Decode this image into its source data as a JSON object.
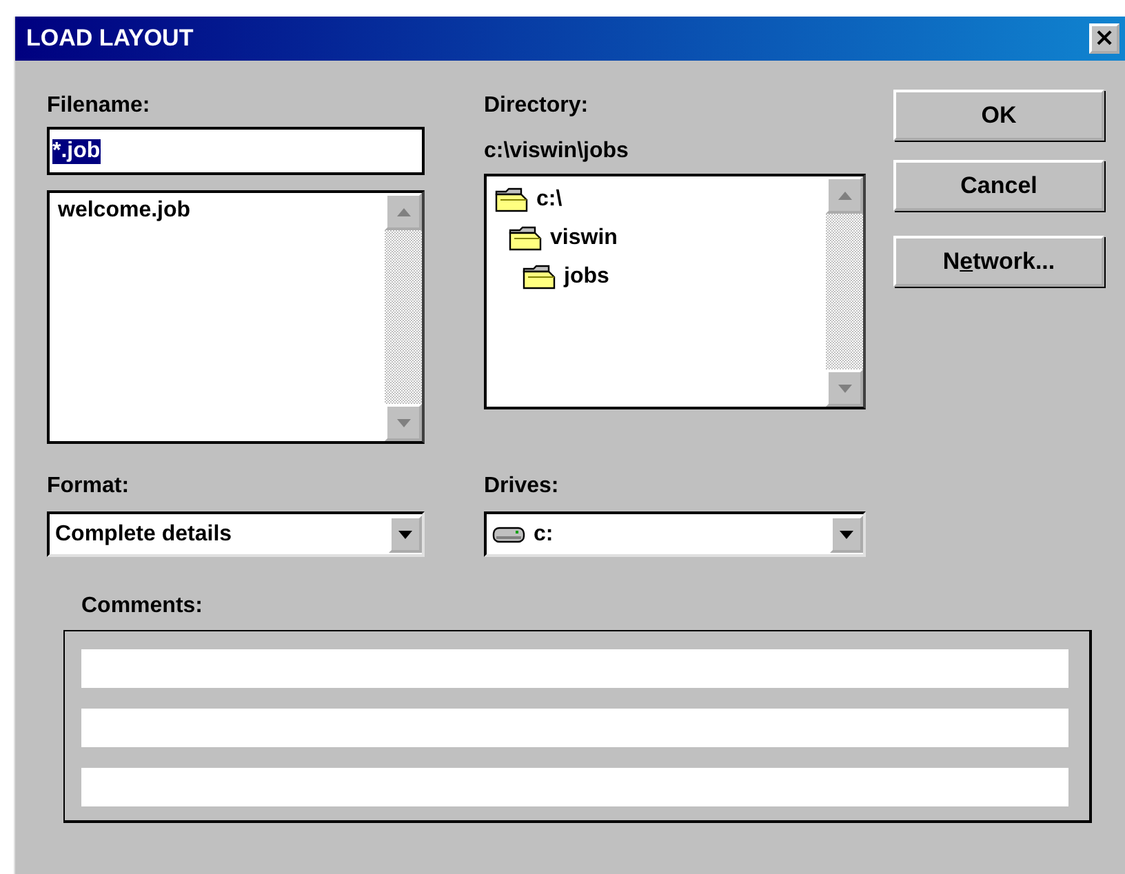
{
  "window": {
    "title": "LOAD LAYOUT",
    "close": "×"
  },
  "filename": {
    "label": "Filename:",
    "value": "*.job",
    "text_selected": true,
    "files": [
      {
        "name": "welcome.job",
        "selected": false
      }
    ]
  },
  "directory": {
    "label": "Directory:",
    "path": "c:\\viswin\\jobs",
    "tree": [
      {
        "name": "c:\\",
        "children": [
          {
            "name": "viswin",
            "children": [
              {
                "name": "jobs"
              }
            ]
          }
        ]
      }
    ]
  },
  "buttons": [
    {
      "label": [
        {
          "text": "OK",
          "underlined": false
        }
      ]
    },
    {
      "label": [
        {
          "text": "Cancel",
          "underlined": false
        }
      ]
    },
    {
      "label": [
        {
          "text": "N",
          "underlined": false
        },
        {
          "text": "e",
          "underlined": true
        },
        {
          "text": "twork...",
          "underlined": false
        }
      ]
    }
  ],
  "format": {
    "label": "Format:",
    "value": "Complete details"
  },
  "drives": {
    "label": "Drives:",
    "value": "c:"
  },
  "comments": {
    "label": "Comments:",
    "lines": [
      {
        "kind": "field"
      },
      {
        "kind": "field"
      },
      {
        "kind": "field"
      }
    ]
  }
}
